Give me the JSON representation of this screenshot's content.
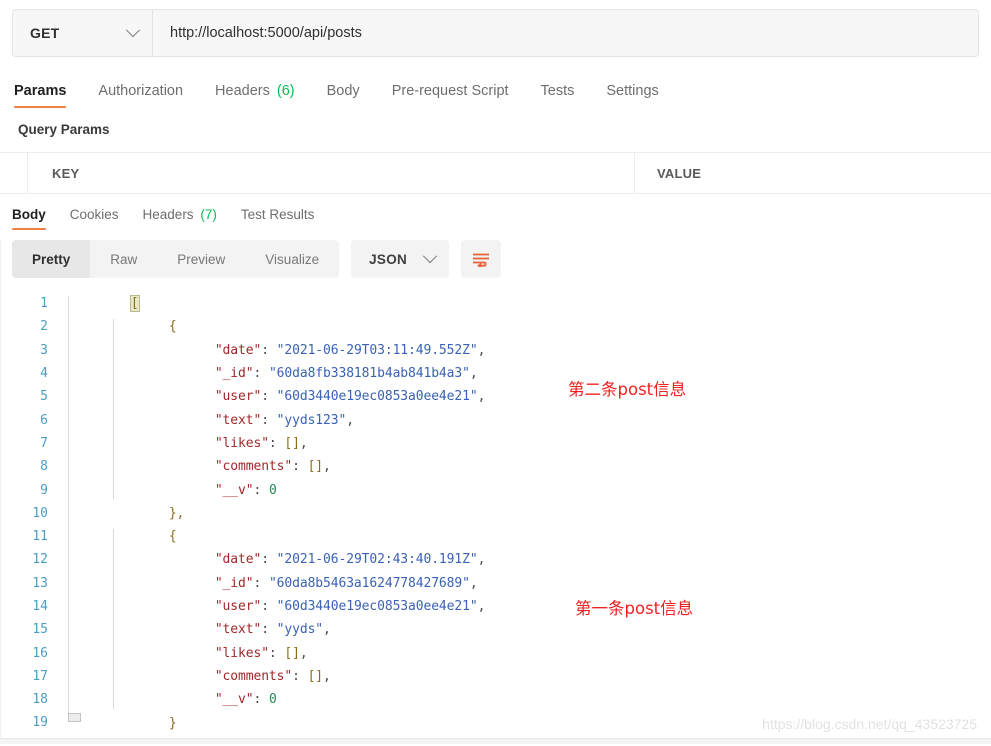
{
  "request": {
    "method": "GET",
    "method_chevron_icon": "chevron-down-icon",
    "url": "http://localhost:5000/api/posts",
    "tabs": [
      {
        "label": "Params",
        "count": null,
        "active": true
      },
      {
        "label": "Authorization",
        "count": null,
        "active": false
      },
      {
        "label": "Headers",
        "count": "(6)",
        "active": false
      },
      {
        "label": "Body",
        "count": null,
        "active": false
      },
      {
        "label": "Pre-request Script",
        "count": null,
        "active": false
      },
      {
        "label": "Tests",
        "count": null,
        "active": false
      },
      {
        "label": "Settings",
        "count": null,
        "active": false
      }
    ],
    "query_params": {
      "title": "Query Params",
      "columns": [
        "KEY",
        "VALUE"
      ]
    }
  },
  "response": {
    "tabs": [
      {
        "label": "Body",
        "count": null,
        "active": true
      },
      {
        "label": "Cookies",
        "count": null,
        "active": false
      },
      {
        "label": "Headers",
        "count": "(7)",
        "active": false
      },
      {
        "label": "Test Results",
        "count": null,
        "active": false
      }
    ],
    "view_modes": [
      {
        "label": "Pretty",
        "active": true
      },
      {
        "label": "Raw",
        "active": false
      },
      {
        "label": "Preview",
        "active": false
      },
      {
        "label": "Visualize",
        "active": false
      }
    ],
    "format": "JSON",
    "format_chevron_icon": "chevron-down-icon",
    "wrap_lines_icon": "wrap-lines-icon"
  },
  "code": {
    "lines": [
      {
        "no": "1",
        "indent": 0
      },
      {
        "no": "2",
        "indent": 1
      },
      {
        "no": "3",
        "indent": 2
      },
      {
        "no": "4",
        "indent": 2
      },
      {
        "no": "5",
        "indent": 2
      },
      {
        "no": "6",
        "indent": 2
      },
      {
        "no": "7",
        "indent": 2
      },
      {
        "no": "8",
        "indent": 2
      },
      {
        "no": "9",
        "indent": 2
      },
      {
        "no": "10",
        "indent": 1
      },
      {
        "no": "11",
        "indent": 1
      },
      {
        "no": "12",
        "indent": 2
      },
      {
        "no": "13",
        "indent": 2
      },
      {
        "no": "14",
        "indent": 2
      },
      {
        "no": "15",
        "indent": 2
      },
      {
        "no": "16",
        "indent": 2
      },
      {
        "no": "17",
        "indent": 2
      },
      {
        "no": "18",
        "indent": 2
      },
      {
        "no": "19",
        "indent": 1
      }
    ],
    "text": {
      "l1": "[",
      "l2": "{",
      "l3_key": "\"date\"",
      "l3_val": "\"2021-06-29T03:11:49.552Z\"",
      "l4_key": "\"_id\"",
      "l4_val": "\"60da8fb338181b4ab841b4a3\"",
      "l5_key": "\"user\"",
      "l5_val": "\"60d3440e19ec0853a0ee4e21\"",
      "l6_key": "\"text\"",
      "l6_val": "\"yyds123\"",
      "l7_key": "\"likes\"",
      "l7_val": "[]",
      "l8_key": "\"comments\"",
      "l8_val": "[]",
      "l9_key": "\"__v\"",
      "l9_val": "0",
      "l10": "},",
      "l11": "{",
      "l12_key": "\"date\"",
      "l12_val": "\"2021-06-29T02:43:40.191Z\"",
      "l13_key": "\"_id\"",
      "l13_val": "\"60da8b5463a1624778427689\"",
      "l14_key": "\"user\"",
      "l14_val": "\"60d3440e19ec0853a0ee4e21\"",
      "l15_key": "\"text\"",
      "l15_val": "\"yyds\"",
      "l16_key": "\"likes\"",
      "l16_val": "[]",
      "l17_key": "\"comments\"",
      "l17_val": "[]",
      "l18_key": "\"__v\"",
      "l18_val": "0",
      "l19": "}",
      "colon": ": ",
      "comma": ","
    }
  },
  "annotations": [
    {
      "text": "第二条post信息"
    },
    {
      "text": "第一条post信息"
    }
  ],
  "watermark": "https://blog.csdn.net/qq_43523725",
  "colors": {
    "accent": "#ef7f42",
    "badge_green": "#0cbb52",
    "annotation_red": "#ef2222",
    "json_key": "#a2272a",
    "json_string": "#3a62b5",
    "json_number": "#1f8a55",
    "line_number": "#4d9cc4"
  }
}
